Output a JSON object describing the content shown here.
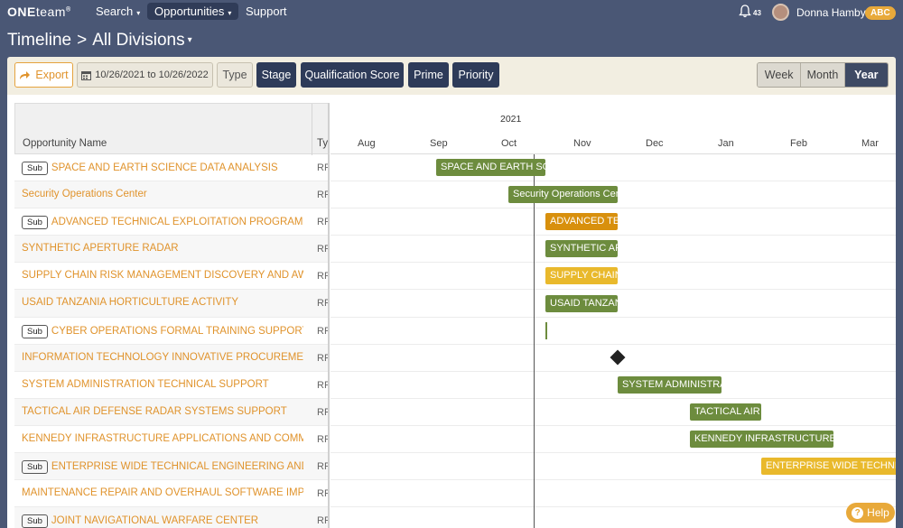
{
  "nav": {
    "logo_bold": "ONE",
    "logo_thin": "team",
    "logo_mark": "®",
    "items": [
      {
        "label": "Search",
        "caret": "▾"
      },
      {
        "label": "Opportunities",
        "caret": "▾"
      },
      {
        "label": "Support",
        "caret": ""
      }
    ],
    "notifications": "43",
    "user": "Donna Hamby",
    "org": "ABC"
  },
  "breadcrumb": {
    "root": "Timeline",
    "sep": ">",
    "current": "All Divisions",
    "caret": "▾"
  },
  "toolbar": {
    "export": "Export",
    "date_range": "10/26/2021 to 10/26/2022",
    "type": "Type",
    "stage": "Stage",
    "qualification": "Qualification Score",
    "prime": "Prime",
    "priority": "Priority",
    "views": [
      "Week",
      "Month",
      "Year"
    ],
    "active_view": "Year"
  },
  "grid": {
    "col_name": "Opportunity Name",
    "col_type": "Ty",
    "rows": [
      {
        "sub": true,
        "name": "SPACE AND EARTH SCIENCE DATA ANALYSIS",
        "type": "RF"
      },
      {
        "sub": false,
        "name": "Security Operations Center",
        "type": "RF"
      },
      {
        "sub": true,
        "name": "ADVANCED TECHNICAL EXPLOITATION PROGRAM",
        "type": "RF"
      },
      {
        "sub": false,
        "name": "SYNTHETIC APERTURE RADAR",
        "type": "RF"
      },
      {
        "sub": false,
        "name": "SUPPLY CHAIN RISK MANAGEMENT DISCOVERY AND AWA...",
        "type": "RF"
      },
      {
        "sub": false,
        "name": "USAID TANZANIA HORTICULTURE ACTIVITY",
        "type": "RF"
      },
      {
        "sub": true,
        "name": "CYBER OPERATIONS FORMAL TRAINING SUPPORT R...",
        "type": "RF"
      },
      {
        "sub": false,
        "name": "INFORMATION TECHNOLOGY INNOVATIVE PROCUREMEN...",
        "type": "RF"
      },
      {
        "sub": false,
        "name": "SYSTEM ADMINISTRATION TECHNICAL SUPPORT",
        "type": "RF"
      },
      {
        "sub": false,
        "name": "TACTICAL AIR DEFENSE RADAR SYSTEMS SUPPORT",
        "type": "RF"
      },
      {
        "sub": false,
        "name": "KENNEDY INFRASTRUCTURE APPLICATIONS AND COMMU...",
        "type": "RF"
      },
      {
        "sub": true,
        "name": "ENTERPRISE WIDE TECHNICAL ENGINEERING AND P...",
        "type": "RF"
      },
      {
        "sub": false,
        "name": "MAINTENANCE REPAIR AND OVERHAUL SOFTWARE IMPLE...",
        "type": "RF"
      },
      {
        "sub": true,
        "name": "JOINT NAVIGATIONAL WARFARE CENTER",
        "type": "RF"
      }
    ],
    "sub_label": "Sub"
  },
  "timeline": {
    "year": "2021",
    "months": [
      "Aug",
      "Sep",
      "Oct",
      "Nov",
      "Dec",
      "Jan",
      "Feb",
      "Mar"
    ],
    "bars": [
      {
        "row": 0,
        "label": "SPACE AND EARTH SCIENCE DATA ANALYSIS",
        "color": "#6d8c3e",
        "kind": "green"
      },
      {
        "row": 1,
        "label": "Security Operations Center",
        "color": "#6d8c3e",
        "kind": "green"
      },
      {
        "row": 2,
        "label": "ADVANCED TECHNICAL EXPLOITATION PROGRAM",
        "color": "#d8900d",
        "kind": "orange"
      },
      {
        "row": 3,
        "label": "SYNTHETIC APERTURE RADAR",
        "color": "#6d8c3e",
        "kind": "green"
      },
      {
        "row": 4,
        "label": "SUPPLY CHAIN RISK MANAGEMENT DISCOVERY AND AWARENESS",
        "color": "#e9b92c",
        "kind": "yellow"
      },
      {
        "row": 5,
        "label": "USAID TANZANIA HORTICULTURE ACTIVITY",
        "color": "#6d8c3e",
        "kind": "green"
      },
      {
        "row": 8,
        "label": "SYSTEM ADMINISTRATION TECHNICAL SUPPORT",
        "color": "#6d8c3e",
        "kind": "green"
      },
      {
        "row": 9,
        "label": "TACTICAL AIR DEFENSE RADAR SYSTEMS SUPPORT",
        "color": "#6d8c3e",
        "kind": "green"
      },
      {
        "row": 10,
        "label": "KENNEDY INFRASTRUCTURE APPLICATIONS AND COMMUNICATIONS",
        "color": "#6d8c3e",
        "kind": "green"
      },
      {
        "row": 11,
        "label": "ENTERPRISE WIDE TECHNICAL ENGINEERING AND PROGRAM",
        "color": "#e9b92c",
        "kind": "yellow"
      }
    ]
  },
  "help": "Help"
}
